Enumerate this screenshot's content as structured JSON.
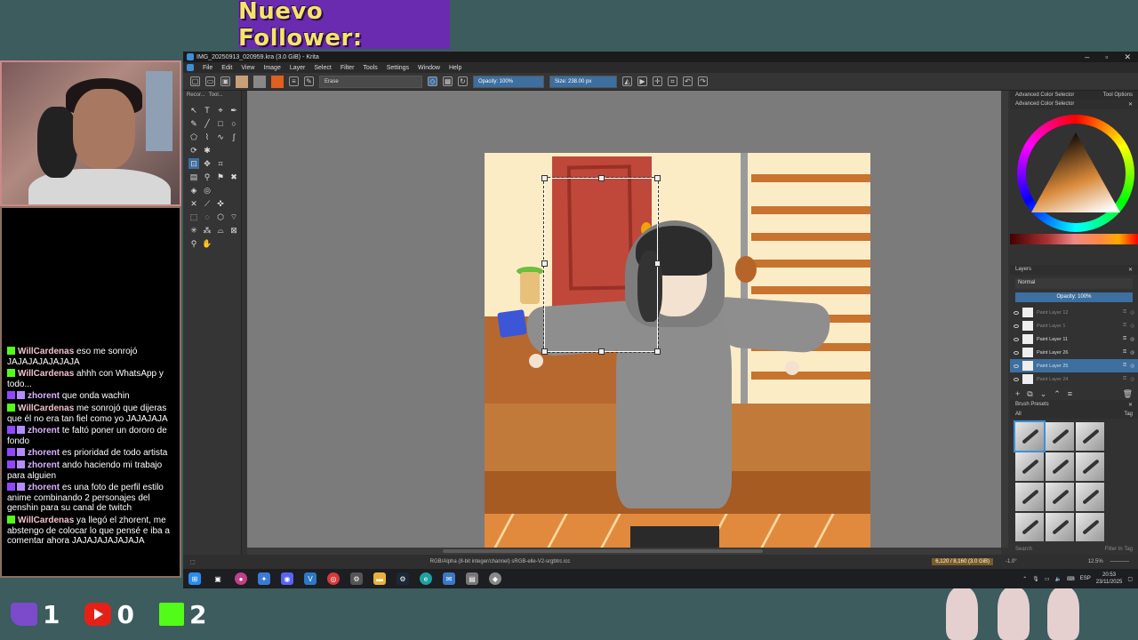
{
  "overlay": {
    "follower_text": "Nuevo Follower:",
    "stats": [
      {
        "platform": "twitch-icon",
        "count": "1"
      },
      {
        "platform": "youtube-icon",
        "count": "0"
      },
      {
        "platform": "kick-icon",
        "count": "2"
      }
    ]
  },
  "chat": [
    {
      "badges": [
        "kick"
      ],
      "user": "WillCardenas",
      "text": "eso me sonrojó JAJAJAJAJAJAJA"
    },
    {
      "badges": [
        "kick"
      ],
      "user": "WillCardenas",
      "text": "ahhh con WhatsApp y todo..."
    },
    {
      "badges": [
        "twitch"
      ],
      "user": "zhorent",
      "text": "que onda wachin"
    },
    {
      "badges": [
        "kick"
      ],
      "user": "WillCardenas",
      "text": "me sonrojó que dijeras que él no era tan fiel como yo JAJAJAJA"
    },
    {
      "badges": [
        "twitch"
      ],
      "user": "zhorent",
      "text": "te faltó poner un dororo de fondo"
    },
    {
      "badges": [
        "twitch"
      ],
      "user": "zhorent",
      "text": "es prioridad de todo artista"
    },
    {
      "badges": [
        "twitch"
      ],
      "user": "zhorent",
      "text": "ando haciendo mi trabajo para alguien"
    },
    {
      "badges": [
        "twitch"
      ],
      "user": "zhorent",
      "text": "es una foto de perfil estilo anime combinando 2 personajes del genshin para su canal de twitch"
    },
    {
      "badges": [
        "kick"
      ],
      "user": "WillCardenas",
      "text": "ya llegó el zhorent, me abstengo de colocar lo que pensé e iba a comentar ahora JAJAJAJAJAJAJA"
    }
  ],
  "krita": {
    "title": "IMG_20250913_020959.kra (3.0 GiB) - Krita",
    "menu": [
      "File",
      "Edit",
      "View",
      "Image",
      "Layer",
      "Select",
      "Filter",
      "Tools",
      "Settings",
      "Window",
      "Help"
    ],
    "blend_mode_tool": "Erase",
    "opacity_field": "Opacity: 100%",
    "size_field": "Size: 238.00 px",
    "toolbox_tabs": [
      "Recor...",
      "Tool..."
    ],
    "status_left": "RGB/Alpha (8-bit integer/channel)  sRGB-elle-V2-srgbtrc.icc",
    "status_memory": "6,120 / 8,160 (3.0 GiB)",
    "status_rotation": "-1.0°",
    "status_zoom": "12.5%",
    "dock_tabs": [
      "Advanced Color Selector",
      "Tool Options"
    ],
    "color_panel_title": "Advanced Color Selector",
    "layers_title": "Layers",
    "layers_blend": "Normal",
    "layers_opacity": "Opacity: 100%",
    "layers": [
      {
        "name": "Paint Layer 12",
        "state": "dim"
      },
      {
        "name": "Paint Layer 1",
        "state": "dim"
      },
      {
        "name": "Paint Layer 11",
        "state": "normal"
      },
      {
        "name": "Paint Layer 26",
        "state": "normal"
      },
      {
        "name": "Paint Layer 25",
        "state": "selected"
      },
      {
        "name": "Paint Layer 24",
        "state": "dim"
      }
    ],
    "brushes_title": "Brush Presets",
    "brush_filter_all": "All",
    "brush_tag": "Tag",
    "brush_search": "Search",
    "filter_in_tag": "Filter In Tag"
  },
  "taskbar": {
    "lang": "ESP",
    "time": "20:53",
    "date": "23/11/2025"
  },
  "colors": {
    "accent": "#3d6fa0",
    "follower_bg": "#6a2bb0",
    "stream_bg": "#3c5c5e"
  }
}
